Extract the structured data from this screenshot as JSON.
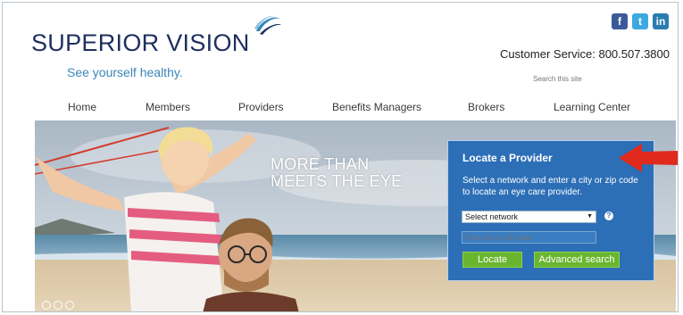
{
  "header": {
    "logo": "SUPERIOR VISION",
    "tagline": "See yourself healthy.",
    "customer_service": "Customer Service: 800.507.3800",
    "search_placeholder": "Search this site",
    "social": [
      {
        "name": "facebook",
        "glyph": "f"
      },
      {
        "name": "twitter",
        "glyph": "t"
      },
      {
        "name": "linkedin",
        "glyph": "in"
      }
    ]
  },
  "nav": [
    {
      "label": "Home"
    },
    {
      "label": "Members"
    },
    {
      "label": "Providers"
    },
    {
      "label": "Benefits Managers"
    },
    {
      "label": "Brokers"
    },
    {
      "label": "Learning Center"
    }
  ],
  "hero": {
    "headline_line1": "MORE THAN",
    "headline_line2": "MEETS THE EYE"
  },
  "locate": {
    "title": "Locate a Provider",
    "description": "Select a network and enter a city or zip code to locate an eye care provider.",
    "network_select": "Select network",
    "help": "?",
    "city_placeholder": "Enter city or zip code",
    "locate_button": "Locate",
    "advanced_button": "Advanced search"
  },
  "colors": {
    "brand": "#1d2f5e",
    "tagline": "#3a86b8",
    "panel": "#2c6fb7",
    "button": "#6ab52f",
    "arrow": "#e02a1e"
  }
}
